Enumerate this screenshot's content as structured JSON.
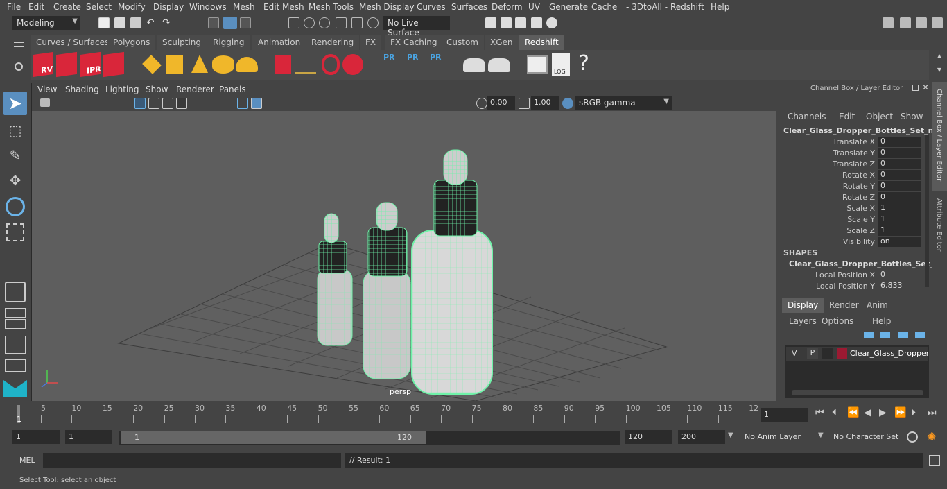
{
  "menubar": {
    "items": [
      "File",
      "Edit",
      "Create",
      "Select",
      "Modify",
      "Display",
      "Windows",
      "Mesh",
      "Edit Mesh",
      "Mesh Tools",
      "Mesh Display",
      "Curves",
      "Surfaces",
      "Deform",
      "UV",
      "Generate",
      "Cache",
      "- 3DtoAll -",
      "Redshift",
      "Help"
    ]
  },
  "statusline": {
    "mode": "Modeling",
    "live_surface": "No Live Surface"
  },
  "shelf": {
    "tabs": [
      "Curves / Surfaces",
      "Polygons",
      "Sculpting",
      "Rigging",
      "Animation",
      "Rendering",
      "FX",
      "FX Caching",
      "Custom",
      "XGen",
      "Redshift"
    ],
    "active_tab": "Redshift",
    "icon_labels": {
      "rv": "RV",
      "ipr": "IPR",
      "pr1": "PR",
      "pr2": "PR",
      "pr3": "PR",
      "log": "LOG",
      "help": "?"
    }
  },
  "viewport": {
    "menu": [
      "View",
      "Shading",
      "Lighting",
      "Show",
      "Renderer",
      "Panels"
    ],
    "exposure": "0.00",
    "gamma": "1.00",
    "color_space": "sRGB gamma",
    "camera_label": "persp"
  },
  "channelbox": {
    "title": "Channel Box / Layer Editor",
    "menu": [
      "Channels",
      "Edit",
      "Object",
      "Show"
    ],
    "object_name": "Clear_Glass_Dropper_Bottles_Set_nc...",
    "attributes": [
      {
        "label": "Translate X",
        "value": "0"
      },
      {
        "label": "Translate Y",
        "value": "0"
      },
      {
        "label": "Translate Z",
        "value": "0"
      },
      {
        "label": "Rotate X",
        "value": "0"
      },
      {
        "label": "Rotate Y",
        "value": "0"
      },
      {
        "label": "Rotate Z",
        "value": "0"
      },
      {
        "label": "Scale X",
        "value": "1"
      },
      {
        "label": "Scale Y",
        "value": "1"
      },
      {
        "label": "Scale Z",
        "value": "1"
      },
      {
        "label": "Visibility",
        "value": "on"
      }
    ],
    "shapes_header": "SHAPES",
    "shape_name": "Clear_Glass_Dropper_Bottles_Set_...",
    "shape_attributes": [
      {
        "label": "Local Position X",
        "value": "0"
      },
      {
        "label": "Local Position Y",
        "value": "6.833"
      }
    ]
  },
  "layer_editor": {
    "tabs": [
      "Display",
      "Render",
      "Anim"
    ],
    "active_tab": "Display",
    "menu": [
      "Layers",
      "Options",
      "Help"
    ],
    "layer": {
      "v": "V",
      "p": "P",
      "name": "Clear_Glass_Dropper_E",
      "color": "#9b1a32"
    }
  },
  "side_tabs": [
    "Channel Box / Layer Editor",
    "Attribute Editor"
  ],
  "timeline": {
    "ticks": [
      "5",
      "10",
      "15",
      "20",
      "25",
      "30",
      "35",
      "40",
      "45",
      "50",
      "55",
      "60",
      "65",
      "70",
      "75",
      "80",
      "85",
      "90",
      "95",
      "100",
      "105",
      "110",
      "115",
      "12"
    ],
    "start_label": "1",
    "current_frame": "1"
  },
  "range": {
    "start": "1",
    "playback_start": "1",
    "slider_start": "1",
    "slider_end": "120",
    "playback_end": "120",
    "end": "200",
    "anim_layer": "No Anim Layer",
    "character_set": "No Character Set"
  },
  "cmdline": {
    "lang": "MEL",
    "result": "// Result: 1"
  },
  "helpline": {
    "text": "Select Tool: select an object"
  },
  "colors": {
    "wire": "#6ef2a8",
    "accent": "#5a9fd6",
    "layer_red": "#9b1a32"
  }
}
